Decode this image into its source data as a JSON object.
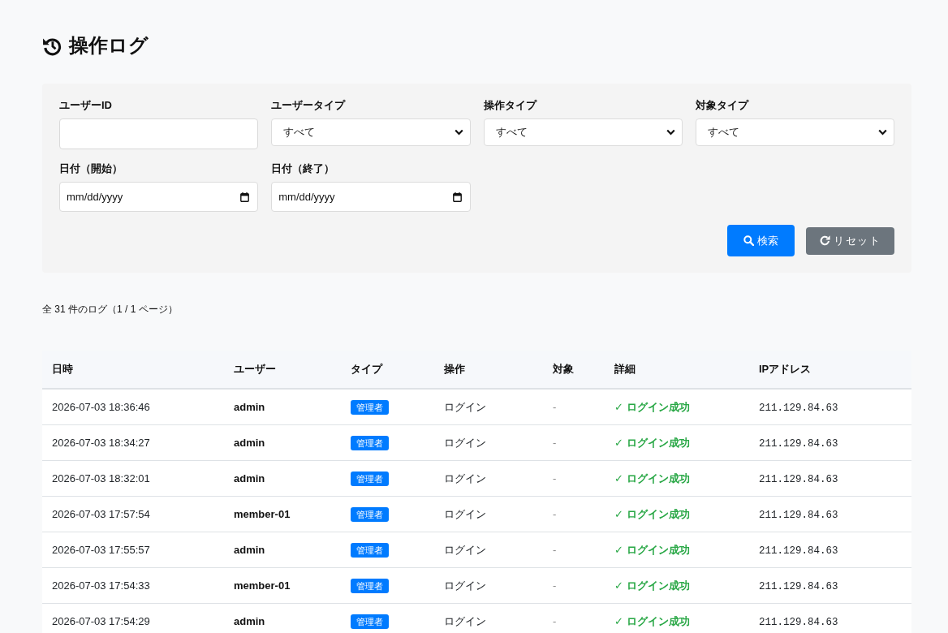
{
  "page": {
    "title": "操作ログ"
  },
  "filters": {
    "fields": [
      {
        "kind": "text",
        "label": "ユーザーID"
      },
      {
        "kind": "select",
        "label": "ユーザータイプ",
        "value": "すべて"
      },
      {
        "kind": "select",
        "label": "操作タイプ",
        "value": "すべて"
      },
      {
        "kind": "select",
        "label": "対象タイプ",
        "value": "すべて"
      },
      {
        "kind": "date",
        "label": "日付（開始）",
        "placeholder": "mm/dd/yyyy"
      },
      {
        "kind": "date",
        "label": "日付（終了）",
        "placeholder": "mm/dd/yyyy"
      }
    ],
    "buttons": [
      {
        "kind": "search",
        "label": "検索"
      },
      {
        "kind": "reset",
        "label": "リセット"
      }
    ]
  },
  "summary": "全 31 件のログ（1 / 1 ページ）",
  "table": {
    "columns": [
      "日時",
      "ユーザー",
      "タイプ",
      "操作",
      "対象",
      "詳細",
      "IPアドレス"
    ],
    "rows": [
      {
        "datetime": "2026-07-03 18:36:46",
        "user": "admin",
        "type": "管理者",
        "action": "ログイン",
        "target": "-",
        "detail": "✓ ログイン成功",
        "ip": "211.129.84.63"
      },
      {
        "datetime": "2026-07-03 18:34:27",
        "user": "admin",
        "type": "管理者",
        "action": "ログイン",
        "target": "-",
        "detail": "✓ ログイン成功",
        "ip": "211.129.84.63"
      },
      {
        "datetime": "2026-07-03 18:32:01",
        "user": "admin",
        "type": "管理者",
        "action": "ログイン",
        "target": "-",
        "detail": "✓ ログイン成功",
        "ip": "211.129.84.63"
      },
      {
        "datetime": "2026-07-03 17:57:54",
        "user": "member-01",
        "type": "管理者",
        "action": "ログイン",
        "target": "-",
        "detail": "✓ ログイン成功",
        "ip": "211.129.84.63"
      },
      {
        "datetime": "2026-07-03 17:55:57",
        "user": "admin",
        "type": "管理者",
        "action": "ログイン",
        "target": "-",
        "detail": "✓ ログイン成功",
        "ip": "211.129.84.63"
      },
      {
        "datetime": "2026-07-03 17:54:33",
        "user": "member-01",
        "type": "管理者",
        "action": "ログイン",
        "target": "-",
        "detail": "✓ ログイン成功",
        "ip": "211.129.84.63"
      },
      {
        "datetime": "2026-07-03 17:54:29",
        "user": "admin",
        "type": "管理者",
        "action": "ログイン",
        "target": "-",
        "detail": "✓ ログイン成功",
        "ip": "211.129.84.63"
      }
    ]
  }
}
